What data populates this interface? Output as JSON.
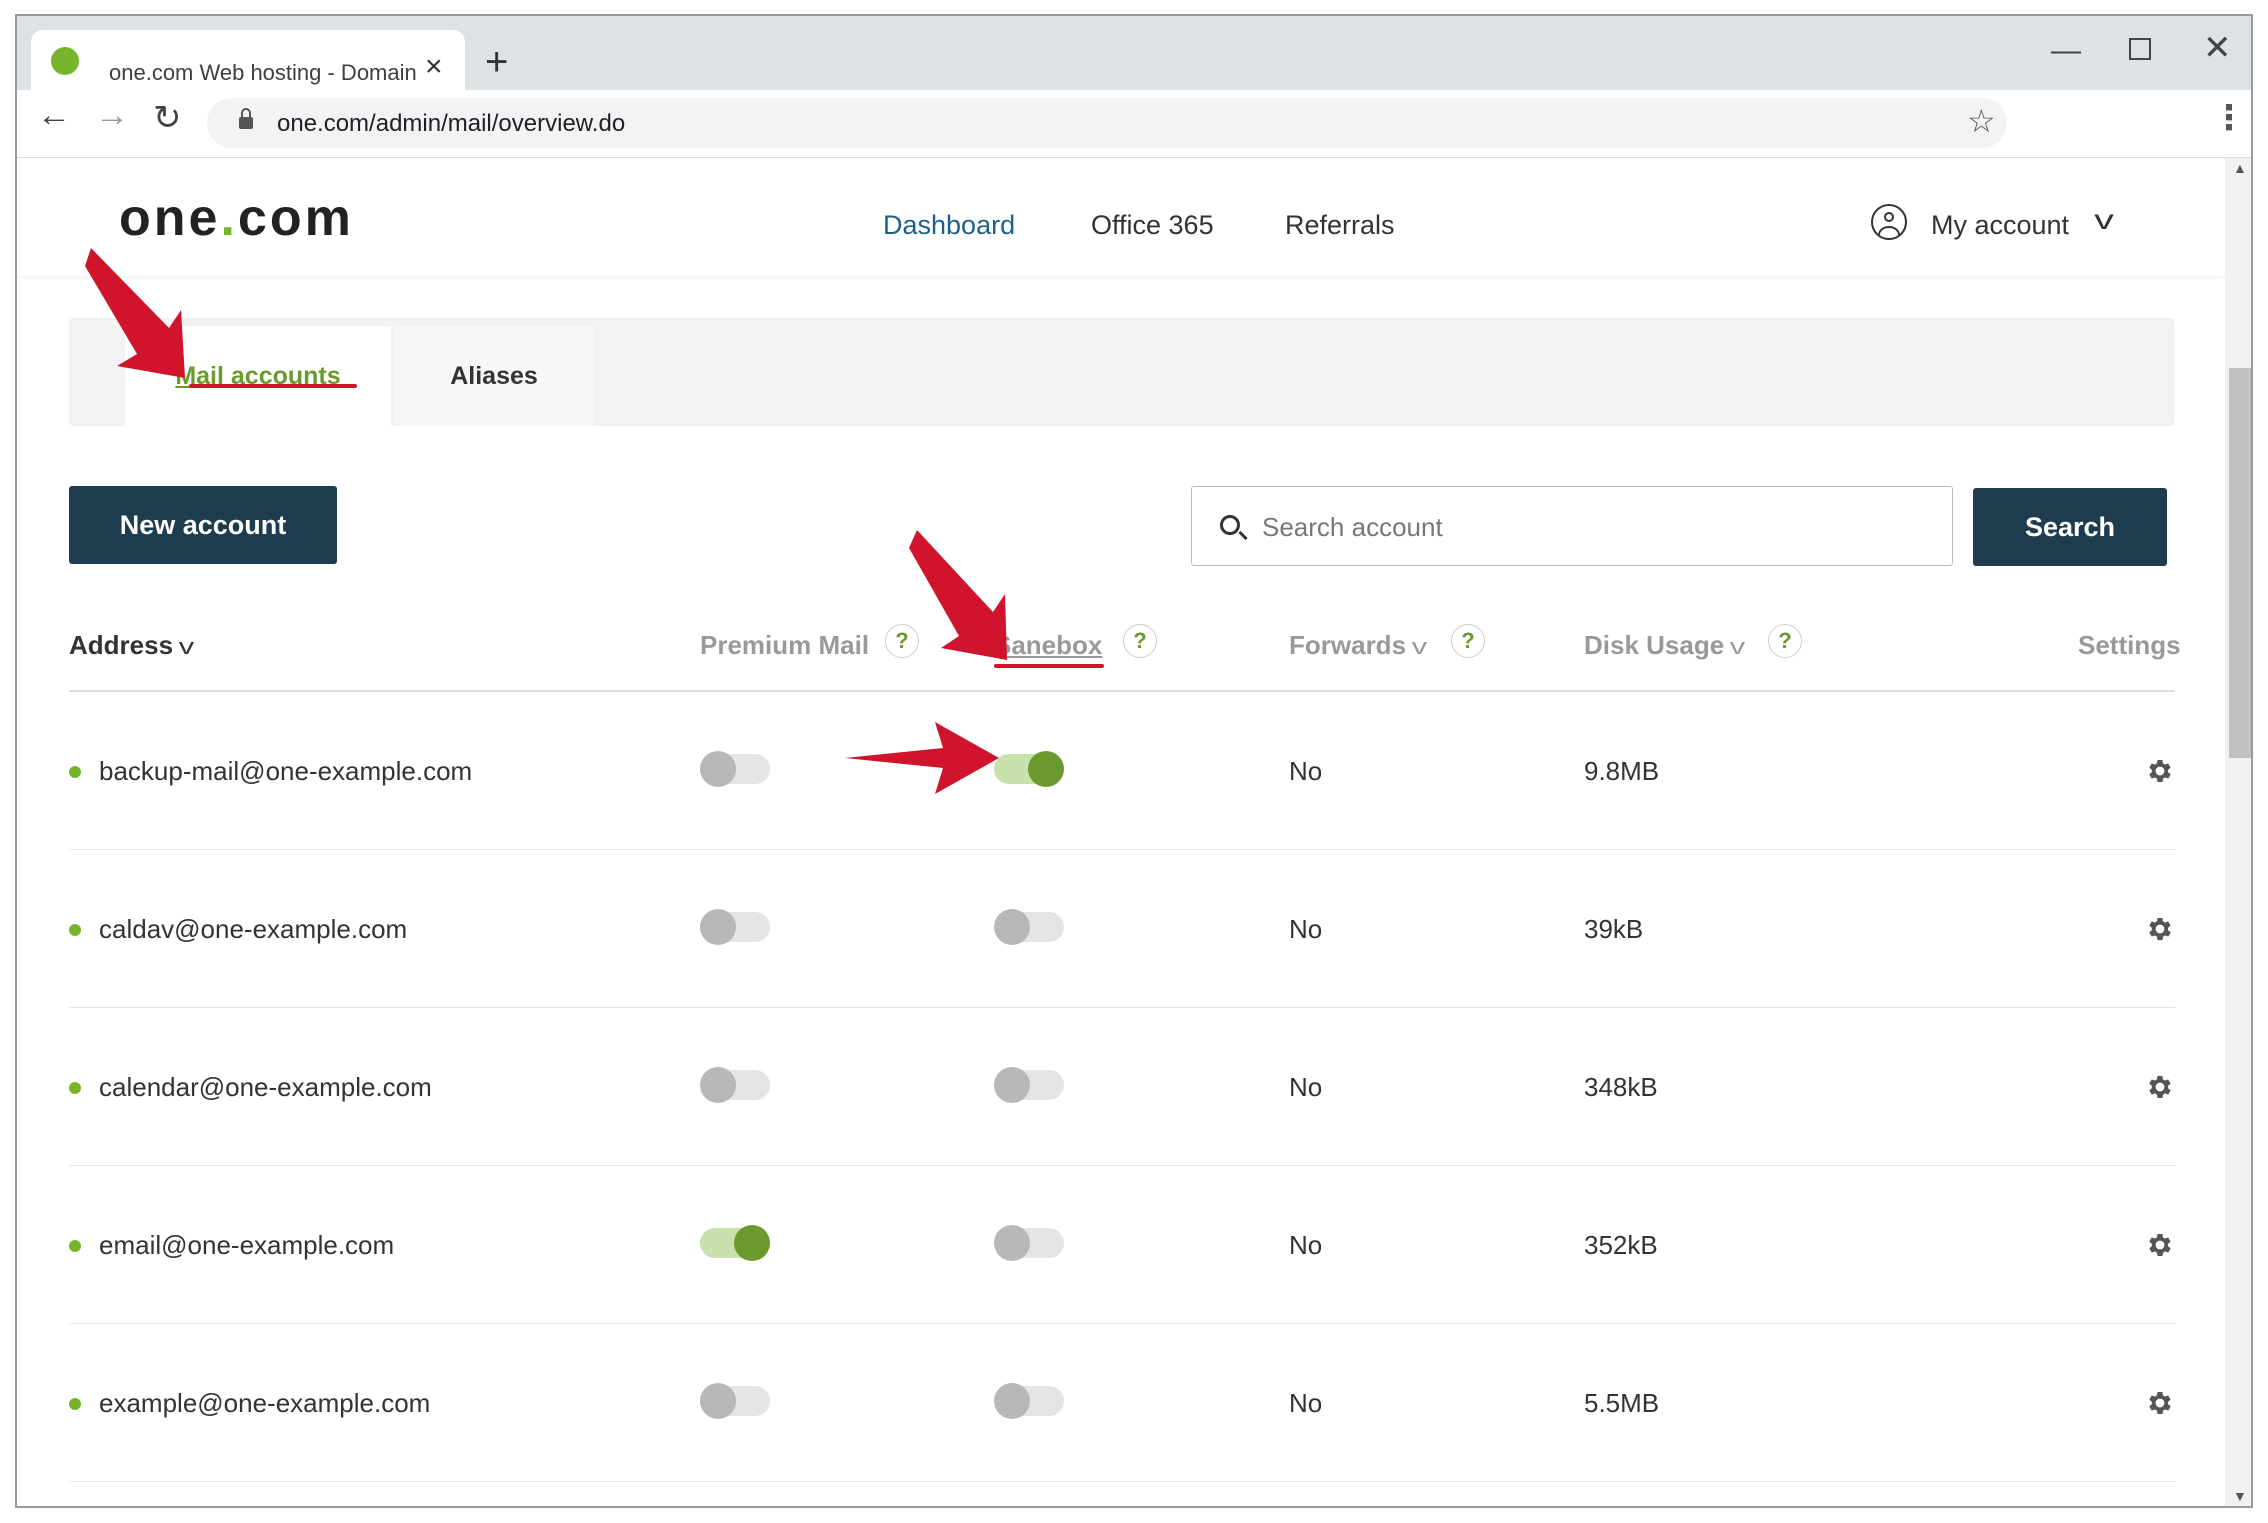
{
  "browser": {
    "tab_title": "one.com Web hosting  -  Domain",
    "tab_close": "×",
    "new_tab": "+",
    "url": "one.com/admin/mail/overview.do"
  },
  "site": {
    "logo_text": "one",
    "logo_dot": ".",
    "logo_suffix": "com",
    "nav": {
      "dashboard": "Dashboard",
      "office365": "Office 365",
      "referrals": "Referrals"
    },
    "account_label": "My account"
  },
  "tabs": {
    "mail_accounts": "Mail accounts",
    "aliases": "Aliases"
  },
  "actions": {
    "new_account": "New account",
    "search_placeholder": "Search account",
    "search_button": "Search"
  },
  "table": {
    "headers": {
      "address": "Address",
      "premium_mail": "Premium Mail",
      "sanebox": "Sanebox",
      "forwards": "Forwards",
      "disk_usage": "Disk Usage",
      "settings": "Settings",
      "help": "?"
    },
    "rows": [
      {
        "address": "backup-mail@one-example.com",
        "premium": false,
        "sanebox": true,
        "forwards": "No",
        "disk": "9.8MB"
      },
      {
        "address": "caldav@one-example.com",
        "premium": false,
        "sanebox": false,
        "forwards": "No",
        "disk": "39kB"
      },
      {
        "address": "calendar@one-example.com",
        "premium": false,
        "sanebox": false,
        "forwards": "No",
        "disk": "348kB"
      },
      {
        "address": "email@one-example.com",
        "premium": true,
        "sanebox": false,
        "forwards": "No",
        "disk": "352kB"
      },
      {
        "address": "example@one-example.com",
        "premium": false,
        "sanebox": false,
        "forwards": "No",
        "disk": "5.5MB"
      }
    ]
  },
  "colors": {
    "brand_green": "#76b52b",
    "toggle_on": "#6a9a2e",
    "button_dark": "#1d3d4f",
    "link_blue": "#1d5f8c",
    "annotation_red": "#d0142c"
  },
  "icons": {
    "tab_favicon": "one-com-favicon",
    "back": "arrow-left-icon",
    "forward": "arrow-right-icon",
    "reload": "reload-icon",
    "lock": "lock-icon",
    "bookmark": "star-icon",
    "menu": "kebab-menu-icon",
    "account": "user-circle-icon",
    "search": "search-icon",
    "settings": "gear-icon"
  }
}
